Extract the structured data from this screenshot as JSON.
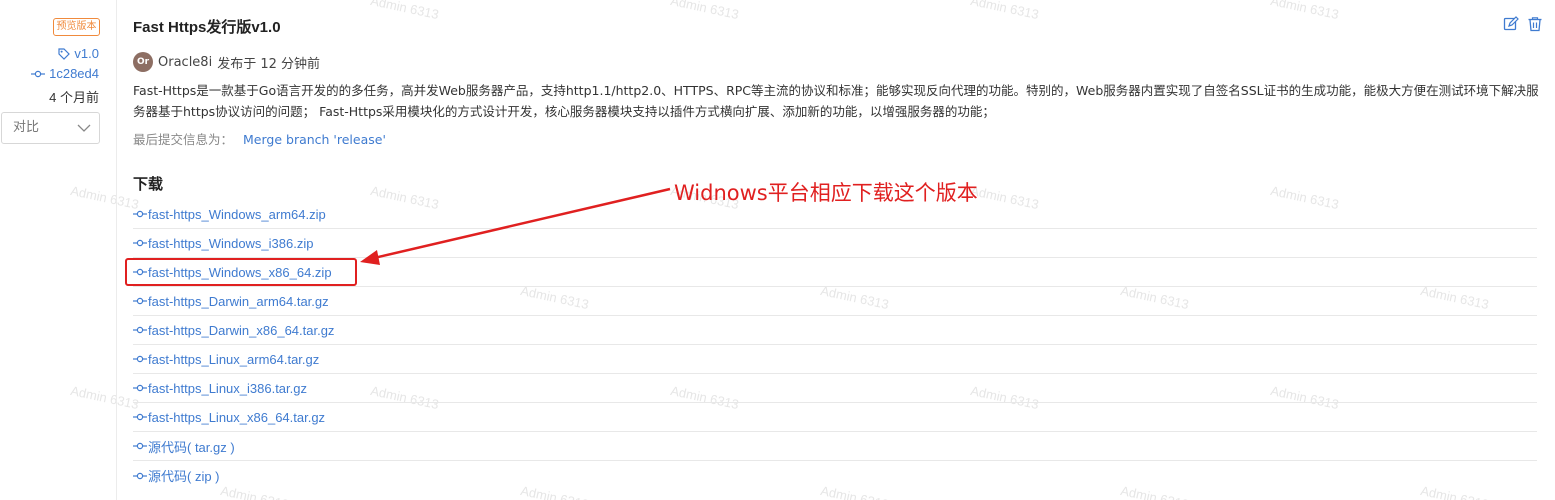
{
  "watermark_text": "Admin 6313",
  "sidebar": {
    "badge": "预览版本",
    "tag": "v1.0",
    "commit": "1c28ed4",
    "time_ago": "4 个月前",
    "compare_label": "对比"
  },
  "release": {
    "title": "Fast Https发行版v1.0",
    "author_initials": "Or",
    "author": "Oracle8i",
    "published": "发布于 12 分钟前",
    "description": "Fast-Https是一款基于Go语言开发的的多任务，高并发Web服务器产品，支持http1.1/http2.0、HTTPS、RPC等主流的协议和标准；能够实现反向代理的功能。特别的，Web服务器内置实现了自签名SSL证书的生成功能，能极大方便在测试环境下解决服务器基于https协议访问的问题； Fast-Https采用模块化的方式设计开发，核心服务器模块支持以插件方式横向扩展、添加新的功能，以增强服务器的功能；",
    "last_commit_label": "最后提交信息为：",
    "last_commit_message": "Merge branch 'release'"
  },
  "downloads": {
    "heading": "下载",
    "items": [
      {
        "label": "fast-https_Windows_arm64.zip"
      },
      {
        "label": "fast-https_Windows_i386.zip"
      },
      {
        "label": "fast-https_Windows_x86_64.zip"
      },
      {
        "label": "fast-https_Darwin_arm64.tar.gz"
      },
      {
        "label": "fast-https_Darwin_x86_64.tar.gz"
      },
      {
        "label": "fast-https_Linux_arm64.tar.gz"
      },
      {
        "label": "fast-https_Linux_i386.tar.gz"
      },
      {
        "label": "fast-https_Linux_x86_64.tar.gz"
      },
      {
        "label": "源代码( tar.gz )"
      },
      {
        "label": "源代码( zip )"
      }
    ]
  },
  "annotation": {
    "text": "Widnows平台相应下载这个版本",
    "color": "#e02020"
  },
  "colors": {
    "link": "#3f7bd0",
    "badge": "#f08a3c"
  }
}
